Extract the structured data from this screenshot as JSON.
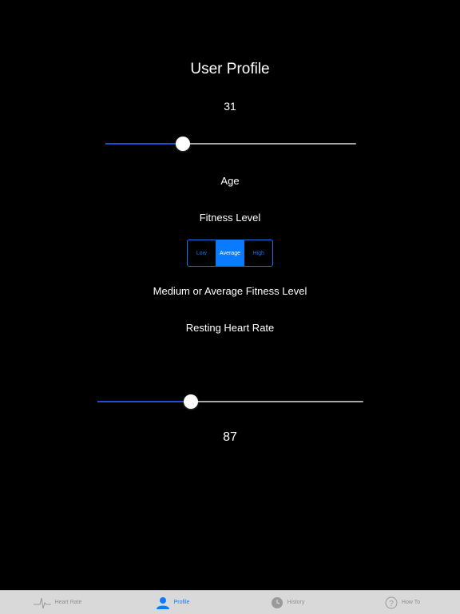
{
  "header": {
    "title": "User Profile"
  },
  "age": {
    "value": "31",
    "label": "Age",
    "slider_fraction": 0.31
  },
  "fitness": {
    "label": "Fitness Level",
    "options": [
      "Low",
      "Average",
      "High"
    ],
    "selected": "Average",
    "description": "Medium or Average Fitness Level"
  },
  "resting_hr": {
    "label": "Resting Heart Rate",
    "value": "87",
    "slider_fraction": 0.35
  },
  "tabs": [
    {
      "label": "Heart Rate",
      "icon": "heartbeat-icon",
      "active": false
    },
    {
      "label": "Profile",
      "icon": "person-icon",
      "active": true
    },
    {
      "label": "History",
      "icon": "clock-icon",
      "active": false
    },
    {
      "label": "How To",
      "icon": "question-icon",
      "active": false
    }
  ],
  "colors": {
    "accent": "#0A7BFF",
    "slider_fill": "#1F4FD6",
    "background": "#000000",
    "tabbar": "#D9D9D9"
  }
}
